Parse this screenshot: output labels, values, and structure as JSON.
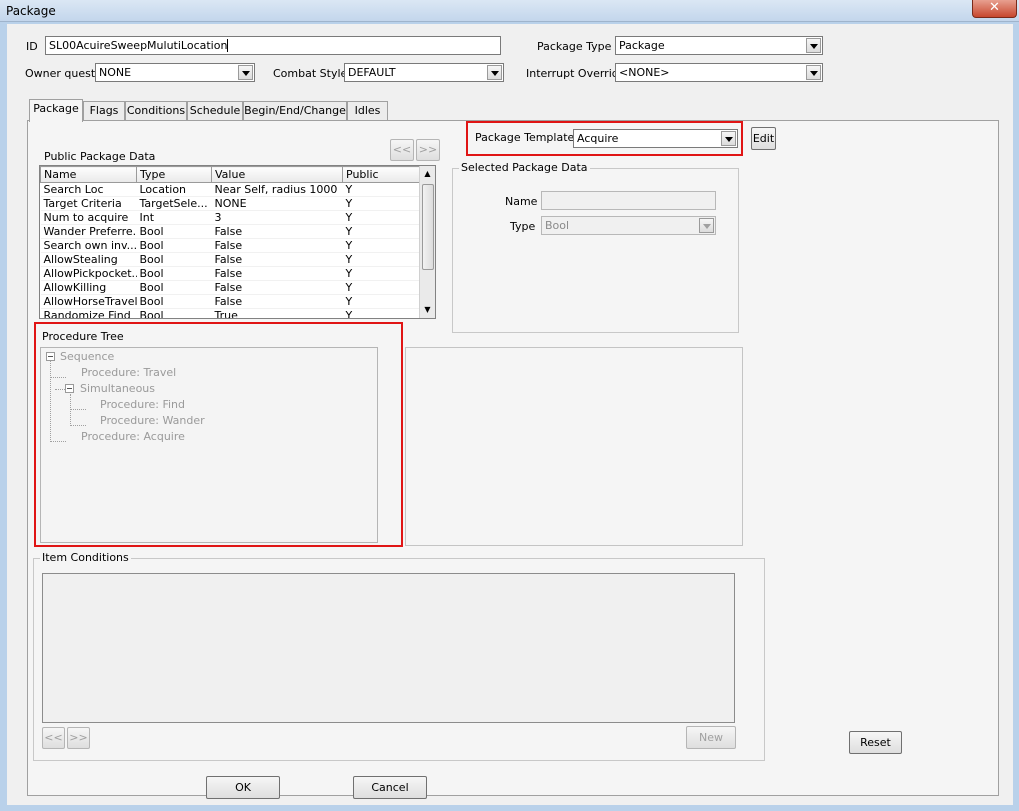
{
  "window": {
    "title": "Package",
    "close_glyph": "✕"
  },
  "fields": {
    "id_label": "ID",
    "id_value": "SL00AcuireSweepMulutiLocation",
    "package_type_label": "Package Type",
    "package_type_value": "Package",
    "owner_quest_label": "Owner quest",
    "owner_quest_value": "NONE",
    "combat_style_label": "Combat Style",
    "combat_style_value": "DEFAULT",
    "interrupt_override_label": "Interrupt Override",
    "interrupt_override_value": "<NONE>"
  },
  "tabs": [
    {
      "label": "Package",
      "active": true
    },
    {
      "label": "Flags"
    },
    {
      "label": "Conditions"
    },
    {
      "label": "Schedule"
    },
    {
      "label": "Begin/End/Change"
    },
    {
      "label": "Idles"
    }
  ],
  "template": {
    "label": "Package Template",
    "value": "Acquire",
    "edit_label": "Edit"
  },
  "public_data": {
    "title": "Public Package Data",
    "prev_label": "<<",
    "next_label": ">>",
    "columns": [
      "Name",
      "Type",
      "Value",
      "Public"
    ],
    "rows": [
      [
        "Search Loc",
        "Location",
        "Near Self, radius 1000",
        "Y"
      ],
      [
        "Target Criteria",
        "TargetSele...",
        " NONE",
        "Y"
      ],
      [
        "Num to acquire",
        "Int",
        "3",
        "Y"
      ],
      [
        "Wander Preferre...",
        "Bool",
        "False",
        "Y"
      ],
      [
        "Search own inv...",
        "Bool",
        "False",
        "Y"
      ],
      [
        "AllowStealing",
        "Bool",
        "False",
        "Y"
      ],
      [
        "AllowPickpocket...",
        "Bool",
        "False",
        "Y"
      ],
      [
        "AllowKilling",
        "Bool",
        "False",
        "Y"
      ],
      [
        "AllowHorseTravel",
        "Bool",
        "False",
        "Y"
      ],
      [
        "Randomize Find",
        "Bool",
        "True",
        "Y"
      ]
    ]
  },
  "selected_data": {
    "title": "Selected Package Data",
    "name_label": "Name",
    "name_value": "",
    "type_label": "Type",
    "type_value": "Bool"
  },
  "procedure_tree": {
    "title": "Procedure Tree",
    "items": [
      "Sequence",
      "Procedure: Travel",
      "Simultaneous",
      "Procedure: Find",
      "Procedure: Wander",
      "Procedure: Acquire"
    ]
  },
  "item_conditions": {
    "title": "Item Conditions",
    "prev_label": "<<",
    "next_label": ">>",
    "new_label": "New"
  },
  "buttons": {
    "reset": "Reset",
    "ok": "OK",
    "cancel": "Cancel"
  },
  "colors": {
    "highlight_box": "#e01515",
    "title_bar": "#c3d6ec",
    "close_button": "#c7472e"
  }
}
